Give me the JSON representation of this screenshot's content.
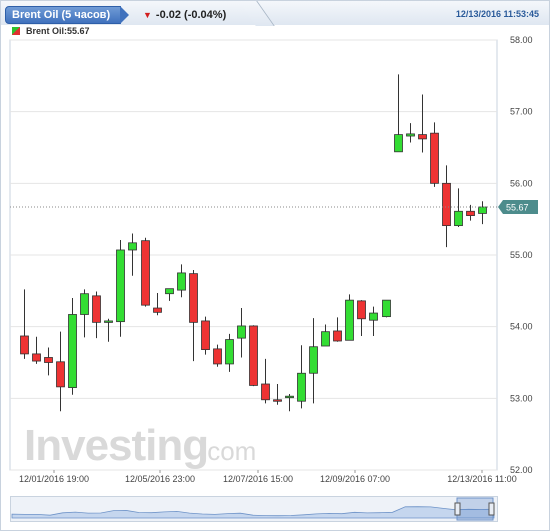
{
  "header": {
    "symbol_tab": "Brent Oil (5 часов)",
    "change": "-0.02 (-0.04%)",
    "datetime": "12/13/2016 11:53:45"
  },
  "legend": {
    "label": "Brent Oil:55.67"
  },
  "watermark": {
    "brand": "Investing",
    "suffix": ".com"
  },
  "colors": {
    "up": "#33dd33",
    "down": "#ee3333",
    "grid": "#e4e4e4",
    "accent": "#3f71bd",
    "price_tag": "#4d8c8c"
  },
  "chart_data": {
    "type": "candlestick",
    "ylim": [
      52,
      58
    ],
    "y_ticks": [
      "52.00",
      "53.00",
      "54.00",
      "55.00",
      "56.00",
      "57.00",
      "58.00"
    ],
    "x_ticks": [
      "12/01/2016 19:00",
      "12/05/2016 23:00",
      "12/07/2016 15:00",
      "12/09/2016 07:00",
      "12/13/2016 11:00"
    ],
    "last_price": "55.67",
    "candles": [
      {
        "o": 53.87,
        "h": 54.52,
        "l": 53.55,
        "c": 53.62
      },
      {
        "o": 53.62,
        "h": 53.86,
        "l": 53.48,
        "c": 53.52
      },
      {
        "o": 53.57,
        "h": 53.71,
        "l": 53.32,
        "c": 53.5
      },
      {
        "o": 53.51,
        "h": 53.93,
        "l": 52.82,
        "c": 53.16
      },
      {
        "o": 53.15,
        "h": 54.4,
        "l": 53.05,
        "c": 54.17
      },
      {
        "o": 54.17,
        "h": 54.52,
        "l": 53.85,
        "c": 54.46
      },
      {
        "o": 54.43,
        "h": 54.49,
        "l": 53.84,
        "c": 54.06
      },
      {
        "o": 54.06,
        "h": 54.11,
        "l": 53.79,
        "c": 54.08
      },
      {
        "o": 54.07,
        "h": 55.21,
        "l": 53.86,
        "c": 55.07
      },
      {
        "o": 55.07,
        "h": 55.3,
        "l": 54.71,
        "c": 55.17
      },
      {
        "o": 55.2,
        "h": 55.24,
        "l": 54.28,
        "c": 54.3
      },
      {
        "o": 54.26,
        "h": 54.47,
        "l": 54.16,
        "c": 54.2
      },
      {
        "o": 54.46,
        "h": 54.52,
        "l": 54.36,
        "c": 54.53
      },
      {
        "o": 54.51,
        "h": 54.87,
        "l": 54.41,
        "c": 54.75
      },
      {
        "o": 54.74,
        "h": 54.79,
        "l": 53.52,
        "c": 54.06
      },
      {
        "o": 54.08,
        "h": 54.14,
        "l": 53.61,
        "c": 53.68
      },
      {
        "o": 53.69,
        "h": 53.75,
        "l": 53.44,
        "c": 53.48
      },
      {
        "o": 53.48,
        "h": 53.9,
        "l": 53.37,
        "c": 53.82
      },
      {
        "o": 53.84,
        "h": 54.26,
        "l": 53.57,
        "c": 54.01
      },
      {
        "o": 54.01,
        "h": 54.02,
        "l": 53.17,
        "c": 53.18
      },
      {
        "o": 53.2,
        "h": 53.55,
        "l": 52.93,
        "c": 52.98
      },
      {
        "o": 52.98,
        "h": 53.2,
        "l": 52.91,
        "c": 52.97
      },
      {
        "o": 53.01,
        "h": 53.06,
        "l": 52.82,
        "c": 53.03
      },
      {
        "o": 52.96,
        "h": 53.74,
        "l": 52.86,
        "c": 53.35
      },
      {
        "o": 53.35,
        "h": 54.12,
        "l": 52.93,
        "c": 53.72
      },
      {
        "o": 53.73,
        "h": 54.03,
        "l": 53.73,
        "c": 53.93
      },
      {
        "o": 53.94,
        "h": 54.13,
        "l": 53.79,
        "c": 53.8
      },
      {
        "o": 53.81,
        "h": 54.45,
        "l": 53.81,
        "c": 54.37
      },
      {
        "o": 54.36,
        "h": 54.37,
        "l": 53.87,
        "c": 54.11
      },
      {
        "o": 54.09,
        "h": 54.28,
        "l": 53.87,
        "c": 54.19
      },
      {
        "o": 54.14,
        "h": 54.37,
        "l": 54.13,
        "c": 54.37
      },
      {
        "o": 56.44,
        "h": 57.52,
        "l": 56.44,
        "c": 56.68
      },
      {
        "o": 56.66,
        "h": 56.84,
        "l": 56.57,
        "c": 56.69
      },
      {
        "o": 56.68,
        "h": 57.24,
        "l": 56.43,
        "c": 56.62
      },
      {
        "o": 56.7,
        "h": 56.85,
        "l": 55.95,
        "c": 56.0
      },
      {
        "o": 56.0,
        "h": 56.25,
        "l": 55.11,
        "c": 55.41
      },
      {
        "o": 55.41,
        "h": 55.93,
        "l": 55.39,
        "c": 55.61
      },
      {
        "o": 55.61,
        "h": 55.7,
        "l": 55.48,
        "c": 55.55
      },
      {
        "o": 55.58,
        "h": 55.75,
        "l": 55.43,
        "c": 55.67
      }
    ]
  }
}
